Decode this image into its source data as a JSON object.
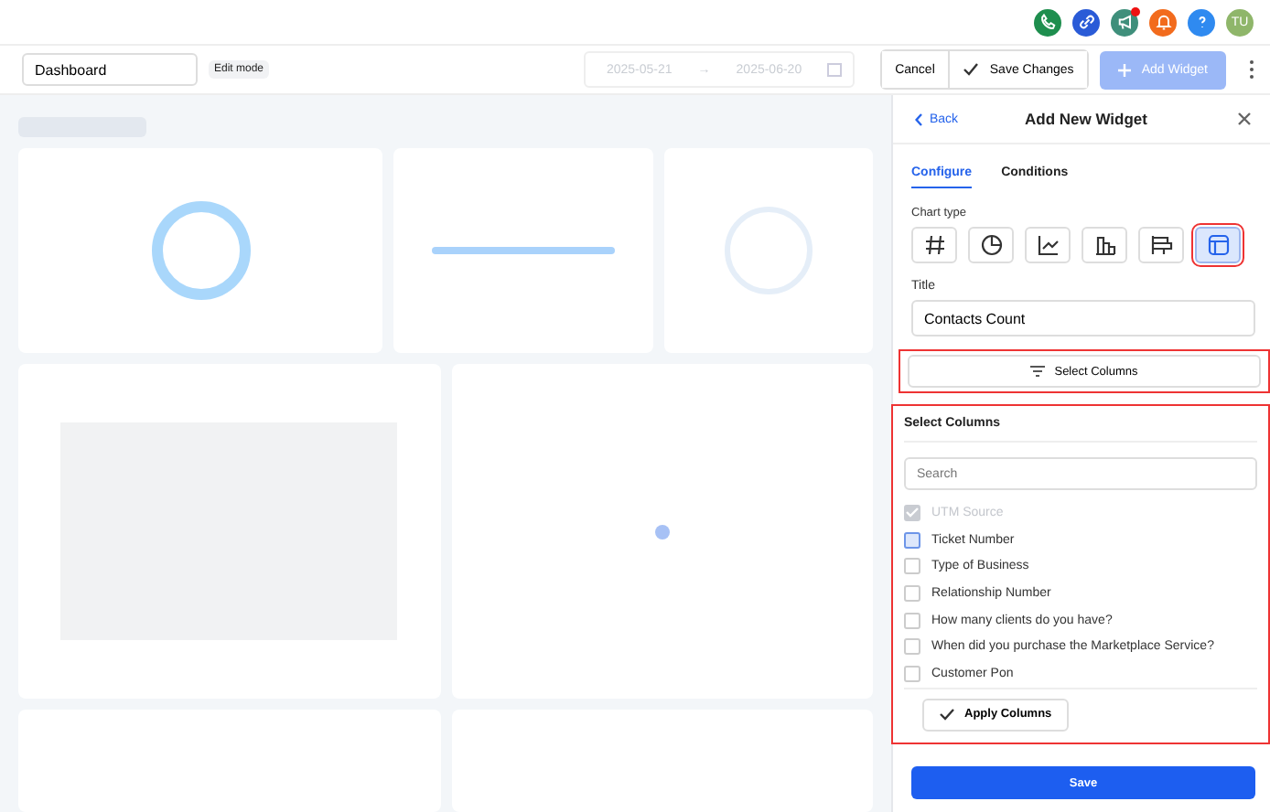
{
  "topbar": {
    "icons": [
      {
        "kind": "phone",
        "color": "#1e8e4e",
        "dot": false
      },
      {
        "kind": "link",
        "color": "#2a5bd7",
        "dot": false
      },
      {
        "kind": "megaphone",
        "color": "#3f8f7b",
        "dot": true
      },
      {
        "kind": "bell",
        "color": "#f26b1d",
        "dot": false
      },
      {
        "kind": "help",
        "color": "#2f8af0",
        "dot": false
      }
    ],
    "avatar": "TU"
  },
  "toolbar": {
    "dashboard_name": "Dashboard",
    "mode_badge": "Edit mode",
    "date_from": "2025-05-21",
    "date_arrow": "→",
    "date_to": "2025-06-20",
    "cancel": "Cancel",
    "save_changes": "Save Changes",
    "add_widget": {
      "label": "Add Widget",
      "disabled": true
    }
  },
  "panel": {
    "back": "Back",
    "title": "Add New Widget",
    "tabs": [
      {
        "label": "Configure",
        "selected": true
      },
      {
        "label": "Conditions",
        "selected": false
      }
    ],
    "chart_type_label": "Chart type",
    "chart_types": [
      {
        "kind": "number",
        "selected": false
      },
      {
        "kind": "pie",
        "selected": false
      },
      {
        "kind": "line",
        "selected": false
      },
      {
        "kind": "bar",
        "selected": false
      },
      {
        "kind": "hbar",
        "selected": false
      },
      {
        "kind": "table",
        "selected": true
      }
    ],
    "title_label": "Title",
    "title_value": "Contacts Count",
    "select_columns_button": "Select Columns",
    "columns_panel": {
      "heading": "Select Columns",
      "search_placeholder": "Search",
      "items": [
        {
          "label": "UTM Source",
          "checked": true,
          "disabled": true,
          "focused": false
        },
        {
          "label": "Ticket Number",
          "checked": false,
          "disabled": false,
          "focused": true
        },
        {
          "label": "Type of Business",
          "checked": false,
          "disabled": false,
          "focused": false
        },
        {
          "label": "Relationship Number",
          "checked": false,
          "disabled": false,
          "focused": false
        },
        {
          "label": "How many clients do you have?",
          "checked": false,
          "disabled": false,
          "focused": false
        },
        {
          "label": "When did you purchase the Marketplace Service?",
          "checked": false,
          "disabled": false,
          "focused": false
        },
        {
          "label": "Customer Pon",
          "checked": false,
          "disabled": false,
          "focused": false
        }
      ],
      "apply": "Apply Columns"
    },
    "save": "Save"
  }
}
